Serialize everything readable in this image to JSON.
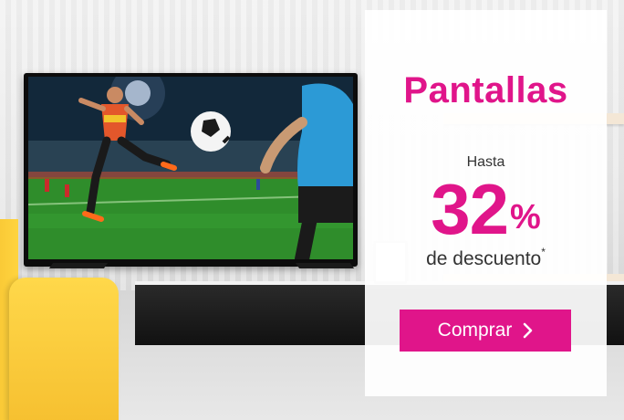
{
  "banner": {
    "title": "Pantallas",
    "lead_text": "Hasta",
    "discount_value": "32",
    "discount_symbol": "%",
    "discount_label": "de descuento",
    "footnote_mark": "*",
    "cta_label": "Comprar",
    "cta_icon": "chevron-right-icon",
    "colors": {
      "accent": "#e0158a",
      "text": "#333333",
      "panel": "#ffffff"
    }
  },
  "scene": {
    "tv_image": "soccer-match-on-tv",
    "chair": "yellow-armchair"
  }
}
